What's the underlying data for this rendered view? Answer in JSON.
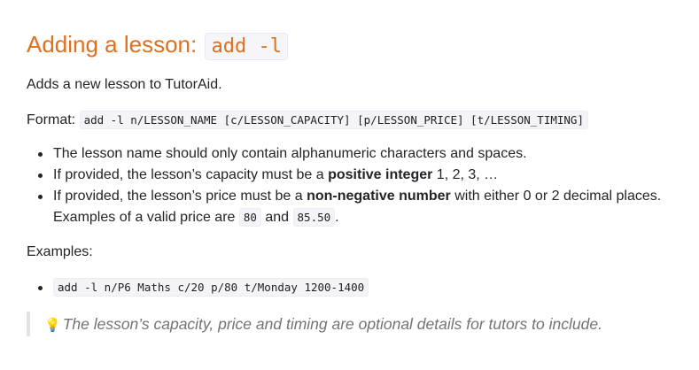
{
  "heading": {
    "text": "Adding a lesson: ",
    "command": "add -l"
  },
  "description": "Adds a new lesson to TutorAid.",
  "format": {
    "label": "Format: ",
    "syntax": "add -l n/LESSON_NAME [c/LESSON_CAPACITY] [p/LESSON_PRICE] [t/LESSON_TIMING]"
  },
  "notes": [
    {
      "text": "The lesson name should only contain alphanumeric characters and spaces."
    },
    {
      "before": "If provided, the lesson’s capacity must be a ",
      "bold": "positive integer",
      "after": " 1, 2, 3, …"
    },
    {
      "before": "If provided, the lesson’s price must be a ",
      "bold": "non-negative number",
      "after": " with either 0 or 2 decimal places.",
      "line2_before": "Examples of a valid price are ",
      "code1": "80",
      "and": " and ",
      "code2": "85.50",
      "end": "."
    }
  ],
  "examples": {
    "label": "Examples:",
    "items": [
      "add -l n/P6 Maths c/20 p/80 t/Monday 1200-1400"
    ]
  },
  "tip": {
    "icon": "lightbulb-icon",
    "text": "The lesson’s capacity, price and timing are optional details for tutors to include."
  },
  "colors": {
    "heading": "#e0701e",
    "text": "#212529",
    "tip_text": "#737373",
    "code_bg": "#f4f4f8"
  }
}
